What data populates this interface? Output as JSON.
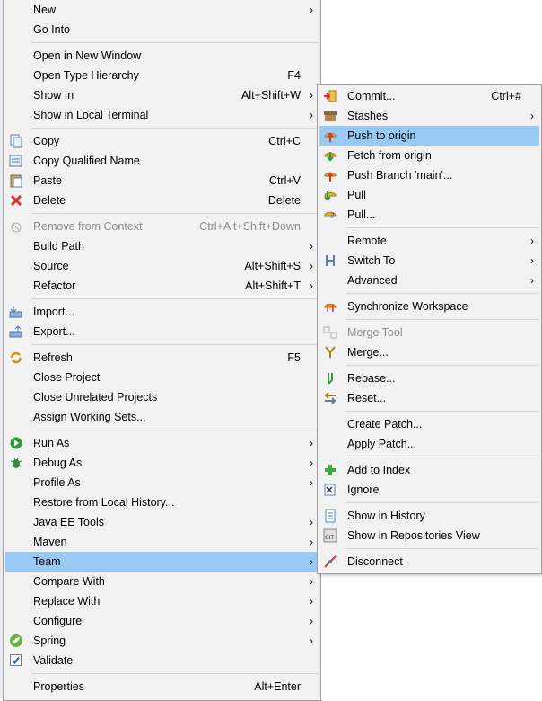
{
  "main_menu": {
    "groups": [
      [
        {
          "label": "New",
          "accel": "",
          "submenu": true,
          "icon": "",
          "disabled": false
        },
        {
          "label": "Go Into",
          "accel": "",
          "submenu": false,
          "icon": "",
          "disabled": false
        }
      ],
      [
        {
          "label": "Open in New Window",
          "accel": "",
          "submenu": false,
          "icon": "",
          "disabled": false
        },
        {
          "label": "Open Type Hierarchy",
          "accel": "F4",
          "submenu": false,
          "icon": "",
          "disabled": false
        },
        {
          "label": "Show In",
          "accel": "Alt+Shift+W",
          "submenu": true,
          "icon": "",
          "disabled": false
        },
        {
          "label": "Show in Local Terminal",
          "accel": "",
          "submenu": true,
          "icon": "",
          "disabled": false
        }
      ],
      [
        {
          "label": "Copy",
          "accel": "Ctrl+C",
          "submenu": false,
          "icon": "copy-icon",
          "disabled": false
        },
        {
          "label": "Copy Qualified Name",
          "accel": "",
          "submenu": false,
          "icon": "copy-qualified-icon",
          "disabled": false
        },
        {
          "label": "Paste",
          "accel": "Ctrl+V",
          "submenu": false,
          "icon": "paste-icon",
          "disabled": false
        },
        {
          "label": "Delete",
          "accel": "Delete",
          "submenu": false,
          "icon": "delete-icon",
          "disabled": false
        }
      ],
      [
        {
          "label": "Remove from Context",
          "accel": "Ctrl+Alt+Shift+Down",
          "submenu": false,
          "icon": "remove-context-icon",
          "disabled": true
        },
        {
          "label": "Build Path",
          "accel": "",
          "submenu": true,
          "icon": "",
          "disabled": false
        },
        {
          "label": "Source",
          "accel": "Alt+Shift+S",
          "submenu": true,
          "icon": "",
          "disabled": false
        },
        {
          "label": "Refactor",
          "accel": "Alt+Shift+T",
          "submenu": true,
          "icon": "",
          "disabled": false
        }
      ],
      [
        {
          "label": "Import...",
          "accel": "",
          "submenu": false,
          "icon": "import-icon",
          "disabled": false
        },
        {
          "label": "Export...",
          "accel": "",
          "submenu": false,
          "icon": "export-icon",
          "disabled": false
        }
      ],
      [
        {
          "label": "Refresh",
          "accel": "F5",
          "submenu": false,
          "icon": "refresh-icon",
          "disabled": false
        },
        {
          "label": "Close Project",
          "accel": "",
          "submenu": false,
          "icon": "",
          "disabled": false
        },
        {
          "label": "Close Unrelated Projects",
          "accel": "",
          "submenu": false,
          "icon": "",
          "disabled": false
        },
        {
          "label": "Assign Working Sets...",
          "accel": "",
          "submenu": false,
          "icon": "",
          "disabled": false
        }
      ],
      [
        {
          "label": "Run As",
          "accel": "",
          "submenu": true,
          "icon": "run-icon",
          "disabled": false
        },
        {
          "label": "Debug As",
          "accel": "",
          "submenu": true,
          "icon": "debug-icon",
          "disabled": false
        },
        {
          "label": "Profile As",
          "accel": "",
          "submenu": true,
          "icon": "",
          "disabled": false
        },
        {
          "label": "Restore from Local History...",
          "accel": "",
          "submenu": false,
          "icon": "",
          "disabled": false
        },
        {
          "label": "Java EE Tools",
          "accel": "",
          "submenu": true,
          "icon": "",
          "disabled": false
        },
        {
          "label": "Maven",
          "accel": "",
          "submenu": true,
          "icon": "",
          "disabled": false
        },
        {
          "label": "Team",
          "accel": "",
          "submenu": true,
          "icon": "",
          "disabled": false,
          "selected": true
        },
        {
          "label": "Compare With",
          "accel": "",
          "submenu": true,
          "icon": "",
          "disabled": false
        },
        {
          "label": "Replace With",
          "accel": "",
          "submenu": true,
          "icon": "",
          "disabled": false
        },
        {
          "label": "Configure",
          "accel": "",
          "submenu": true,
          "icon": "",
          "disabled": false
        },
        {
          "label": "Spring",
          "accel": "",
          "submenu": true,
          "icon": "spring-icon",
          "disabled": false
        },
        {
          "label": "Validate",
          "accel": "",
          "submenu": false,
          "icon": "validate-check-icon",
          "disabled": false
        }
      ],
      [
        {
          "label": "Properties",
          "accel": "Alt+Enter",
          "submenu": false,
          "icon": "",
          "disabled": false
        }
      ]
    ]
  },
  "team_menu": {
    "groups": [
      [
        {
          "label": "Commit...",
          "accel": "Ctrl+#",
          "submenu": false,
          "icon": "commit-icon",
          "disabled": false
        },
        {
          "label": "Stashes",
          "accel": "",
          "submenu": true,
          "icon": "stashes-icon",
          "disabled": false
        },
        {
          "label": "Push to origin",
          "accel": "",
          "submenu": false,
          "icon": "push-icon",
          "disabled": false,
          "selected": true
        },
        {
          "label": "Fetch from origin",
          "accel": "",
          "submenu": false,
          "icon": "fetch-icon",
          "disabled": false
        },
        {
          "label": "Push Branch 'main'...",
          "accel": "",
          "submenu": false,
          "icon": "push-branch-icon",
          "disabled": false
        },
        {
          "label": "Pull",
          "accel": "",
          "submenu": false,
          "icon": "pull-icon",
          "disabled": false
        },
        {
          "label": "Pull...",
          "accel": "",
          "submenu": false,
          "icon": "pull-dialog-icon",
          "disabled": false
        }
      ],
      [
        {
          "label": "Remote",
          "accel": "",
          "submenu": true,
          "icon": "",
          "disabled": false
        },
        {
          "label": "Switch To",
          "accel": "",
          "submenu": true,
          "icon": "switch-branch-icon",
          "disabled": false
        },
        {
          "label": "Advanced",
          "accel": "",
          "submenu": true,
          "icon": "",
          "disabled": false
        }
      ],
      [
        {
          "label": "Synchronize Workspace",
          "accel": "",
          "submenu": false,
          "icon": "synchronize-icon",
          "disabled": false
        }
      ],
      [
        {
          "label": "Merge Tool",
          "accel": "",
          "submenu": false,
          "icon": "merge-tool-icon",
          "disabled": true
        },
        {
          "label": "Merge...",
          "accel": "",
          "submenu": false,
          "icon": "merge-icon",
          "disabled": false
        }
      ],
      [
        {
          "label": "Rebase...",
          "accel": "",
          "submenu": false,
          "icon": "rebase-icon",
          "disabled": false
        },
        {
          "label": "Reset...",
          "accel": "",
          "submenu": false,
          "icon": "reset-icon",
          "disabled": false
        }
      ],
      [
        {
          "label": "Create Patch...",
          "accel": "",
          "submenu": false,
          "icon": "",
          "disabled": false
        },
        {
          "label": "Apply Patch...",
          "accel": "",
          "submenu": false,
          "icon": "",
          "disabled": false
        }
      ],
      [
        {
          "label": "Add to Index",
          "accel": "",
          "submenu": false,
          "icon": "add-index-icon",
          "disabled": false
        },
        {
          "label": "Ignore",
          "accel": "",
          "submenu": false,
          "icon": "ignore-icon",
          "disabled": false
        }
      ],
      [
        {
          "label": "Show in History",
          "accel": "",
          "submenu": false,
          "icon": "history-icon",
          "disabled": false
        },
        {
          "label": "Show in Repositories View",
          "accel": "",
          "submenu": false,
          "icon": "repositories-icon",
          "disabled": false
        }
      ],
      [
        {
          "label": "Disconnect",
          "accel": "",
          "submenu": false,
          "icon": "disconnect-icon",
          "disabled": false
        }
      ]
    ]
  },
  "arrow_glyph": "›"
}
